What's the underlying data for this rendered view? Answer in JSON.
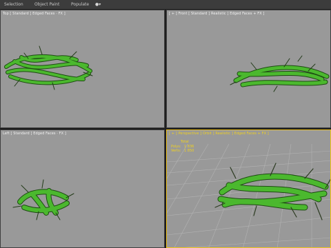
{
  "menubar": {
    "items": [
      {
        "label": "Selection"
      },
      {
        "label": "Object Paint"
      },
      {
        "label": "Populate"
      }
    ],
    "extra_icon": "teapot-icon"
  },
  "viewports": {
    "top": {
      "label": "Top [ Standard ] Edged Faces · FX ]"
    },
    "front": {
      "label": "[ + ] Front [ Standard ] Realistic ] Edged Faces + FX ]"
    },
    "left": {
      "label": "Left [ Standard ] Edged Faces · FX ]"
    },
    "perspective": {
      "label": "[ + ] Perspective ] Orbit ] Realistic ] Edged Faces + FX ]",
      "stats": {
        "title": "Total",
        "rows": [
          {
            "key": "Polys:",
            "value": "1 836"
          },
          {
            "key": "Verts:",
            "value": "1 850"
          }
        ]
      }
    }
  },
  "colors": {
    "viewport_bg": "#999999",
    "active_border": "#f2c51b",
    "vine": "#4bb82e",
    "vine_dark": "#1d4a12",
    "grid": "#b0b0b0"
  }
}
